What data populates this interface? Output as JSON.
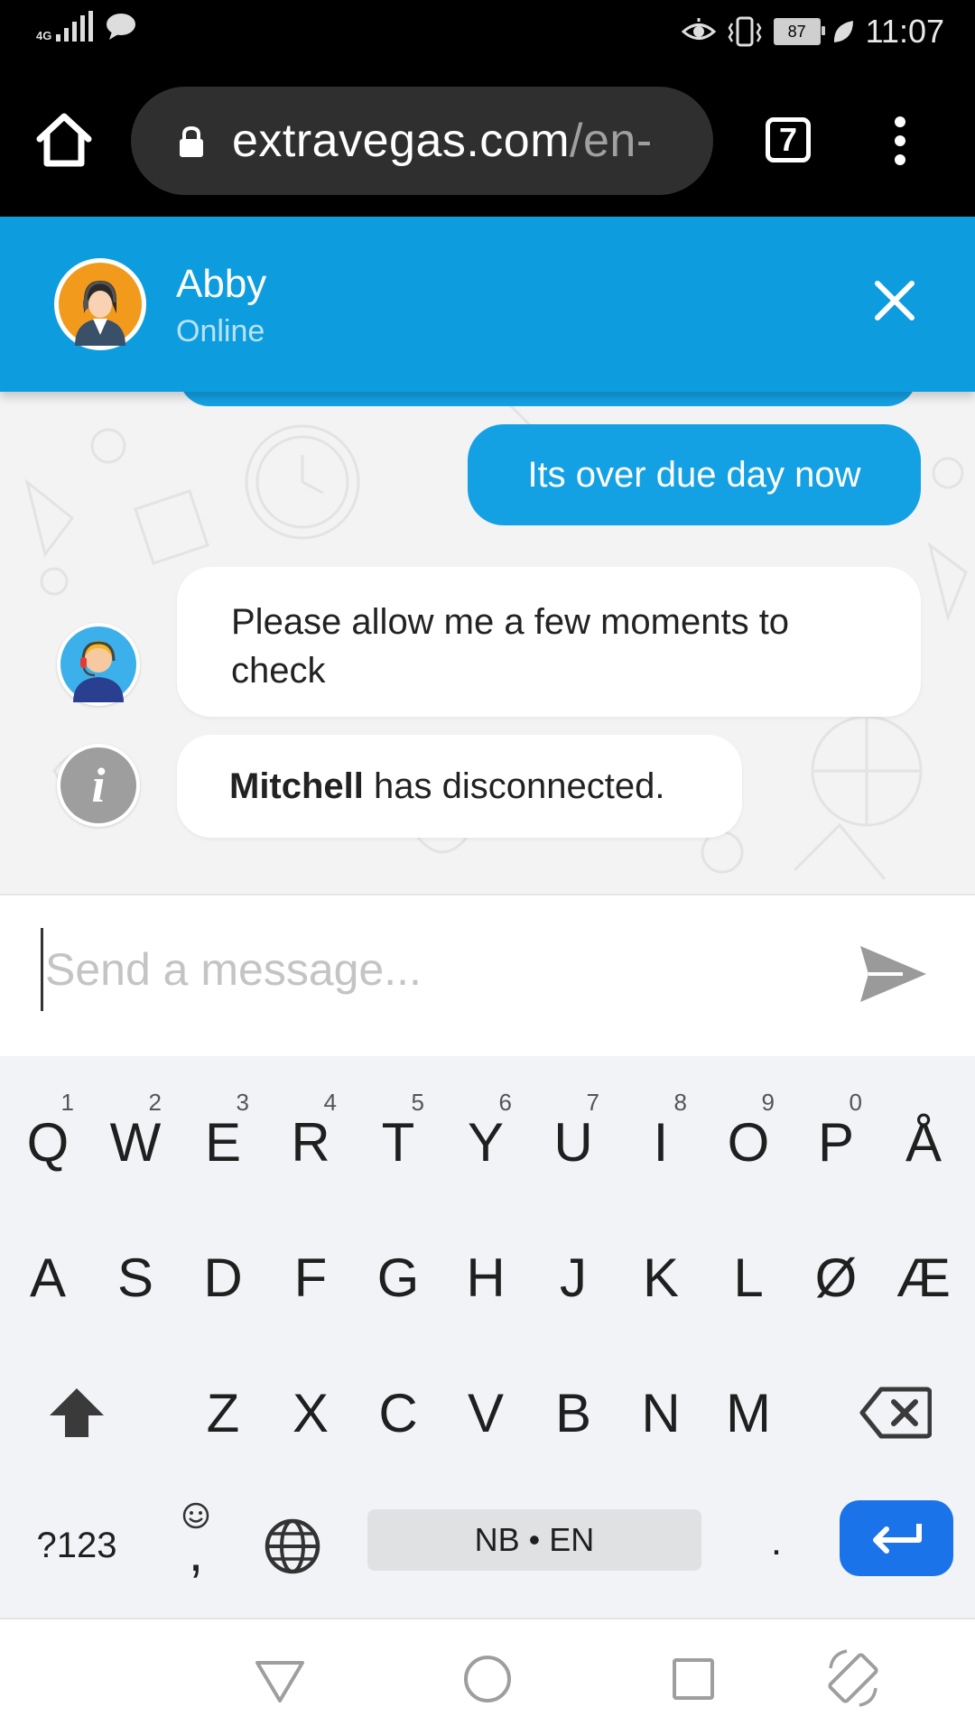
{
  "status_bar": {
    "network": "4G",
    "battery": "87",
    "time": "11:07"
  },
  "browser": {
    "url_main": "extravegas.com",
    "url_rest": "/en-",
    "tab_count": "7"
  },
  "chat": {
    "agent_name": "Abby",
    "agent_status": "Online",
    "messages": [
      {
        "from": "user",
        "text": "Its over due day now"
      },
      {
        "from": "agent",
        "text": "Please allow me a few moments to check"
      },
      {
        "from": "system",
        "bold": "Mitchell",
        "text": " has disconnected."
      }
    ],
    "input_placeholder": "Send a message..."
  },
  "keyboard": {
    "row1": [
      {
        "k": "Q",
        "h": "1"
      },
      {
        "k": "W",
        "h": "2"
      },
      {
        "k": "E",
        "h": "3"
      },
      {
        "k": "R",
        "h": "4"
      },
      {
        "k": "T",
        "h": "5"
      },
      {
        "k": "Y",
        "h": "6"
      },
      {
        "k": "U",
        "h": "7"
      },
      {
        "k": "I",
        "h": "8"
      },
      {
        "k": "O",
        "h": "9"
      },
      {
        "k": "P",
        "h": "0"
      },
      {
        "k": "Å",
        "h": ""
      }
    ],
    "row2": [
      "A",
      "S",
      "D",
      "F",
      "G",
      "H",
      "J",
      "K",
      "L",
      "Ø",
      "Æ"
    ],
    "row3": [
      "Z",
      "X",
      "C",
      "V",
      "B",
      "N",
      "M"
    ],
    "symbols_label": "?123",
    "comma_label": ",",
    "space_label": "NB • EN",
    "period_label": "."
  },
  "colors": {
    "header": "#0d9ddf",
    "outgoing_bubble": "#14a1e4",
    "enter_key": "#1a73e8"
  }
}
